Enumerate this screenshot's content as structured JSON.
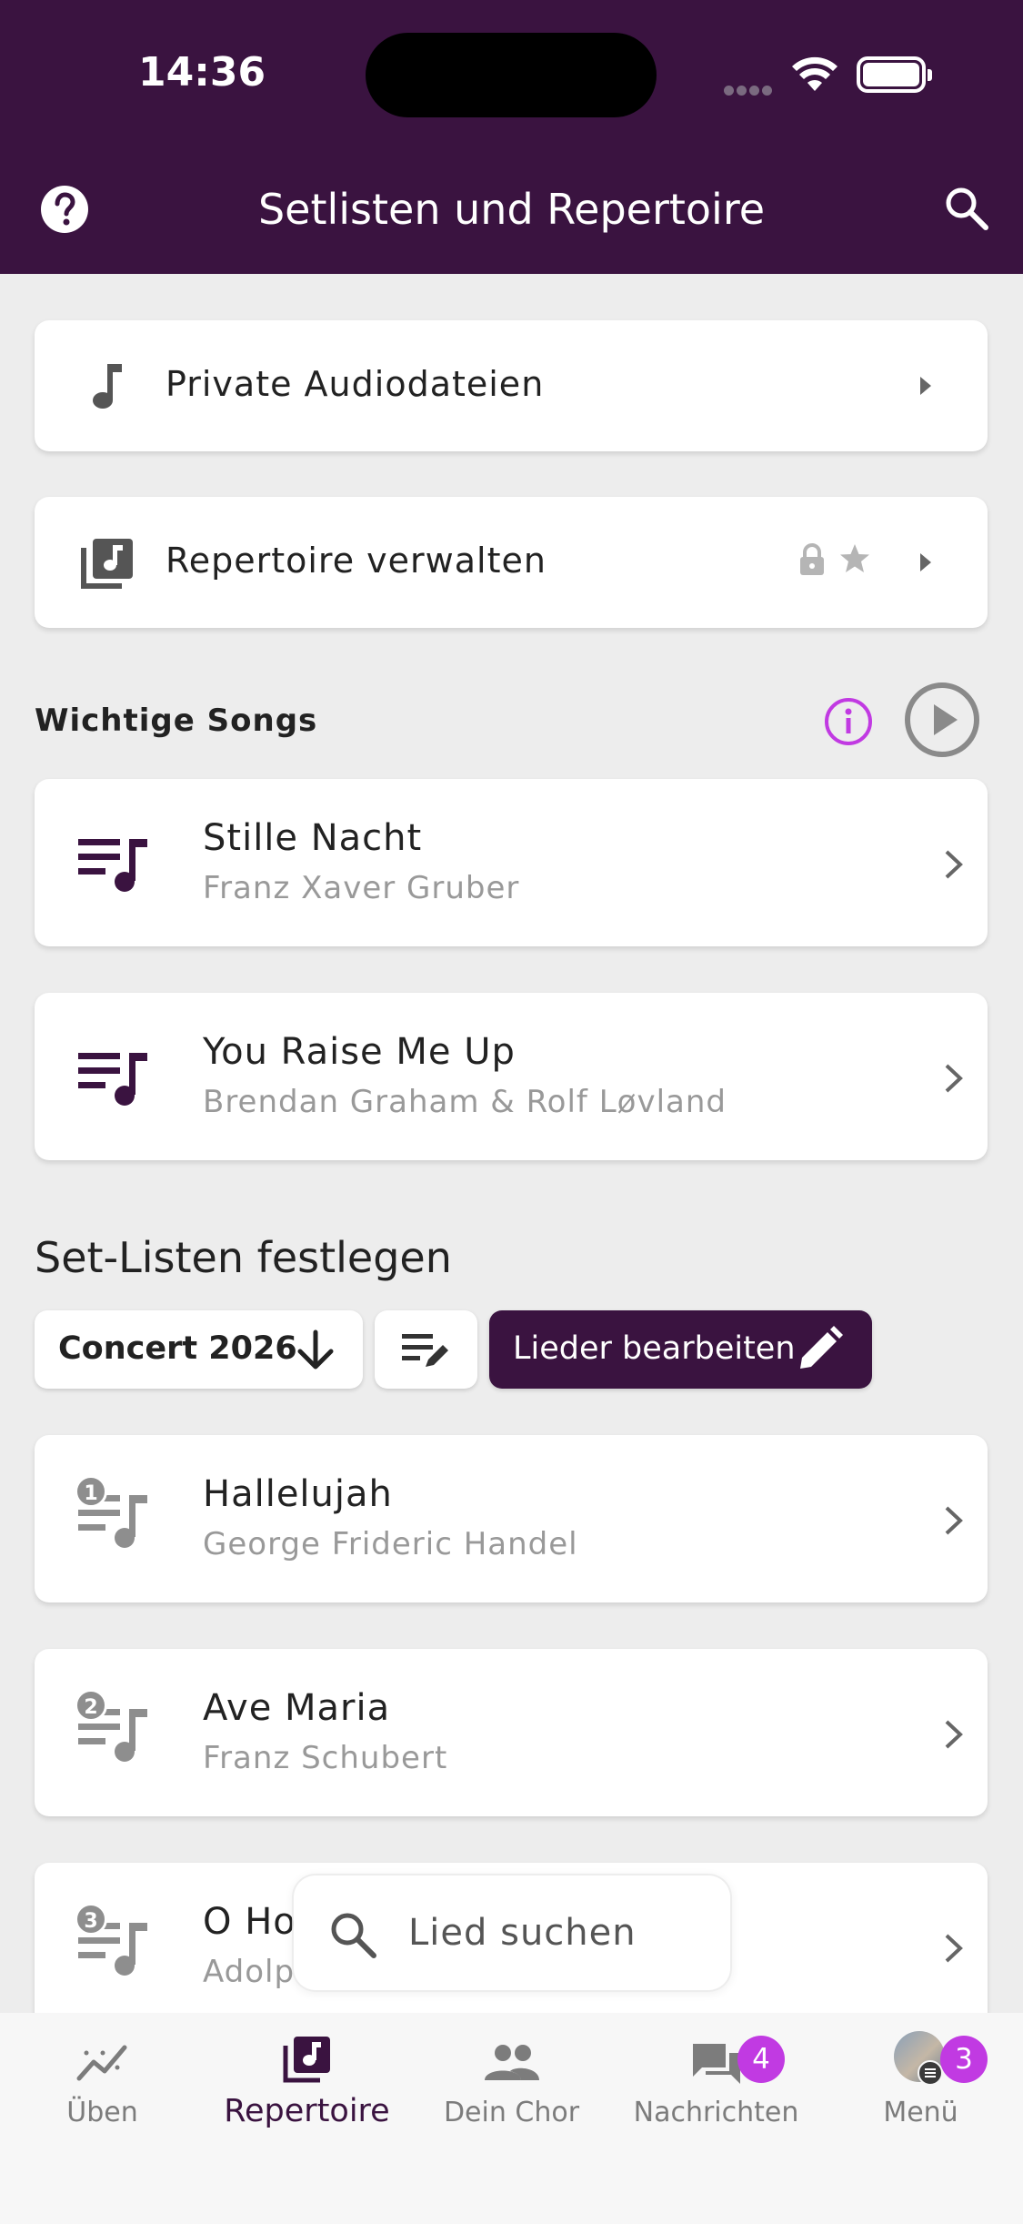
{
  "status_bar": {
    "time": "14:36"
  },
  "header": {
    "title": "Setlisten und Repertoire"
  },
  "menu_rows": [
    {
      "label": "Private Audiodateien"
    },
    {
      "label": "Repertoire verwalten"
    }
  ],
  "important": {
    "label": "Wichtige Songs",
    "songs": [
      {
        "title": "Stille Nacht",
        "composer": "Franz Xaver Gruber"
      },
      {
        "title": "You Raise Me Up",
        "composer": "Brendan Graham & Rolf Løvland"
      }
    ]
  },
  "setlists": {
    "heading": "Set-Listen festlegen",
    "selected": "Concert 2026",
    "edit_songs_label": "Lieder bearbeiten",
    "songs": [
      {
        "number": "1",
        "title": "Hallelujah",
        "composer": "George Frideric Handel"
      },
      {
        "number": "2",
        "title": "Ave Maria",
        "composer": "Franz Schubert"
      },
      {
        "number": "3",
        "title": "O Ho",
        "composer": "Adolp"
      }
    ]
  },
  "search": {
    "placeholder": "Lied suchen"
  },
  "tabs": [
    {
      "label": "Üben",
      "icon": "chart-line-icon"
    },
    {
      "label": "Repertoire",
      "icon": "music-library-icon"
    },
    {
      "label": "Dein Chor",
      "icon": "people-icon"
    },
    {
      "label": "Nachrichten",
      "icon": "chat-icon",
      "badge": "4"
    },
    {
      "label": "Menü",
      "icon": "avatar-icon",
      "badge": "3"
    }
  ],
  "colors": {
    "brand": "#3a1340",
    "accent": "#c13ae2",
    "background": "#ededed"
  }
}
